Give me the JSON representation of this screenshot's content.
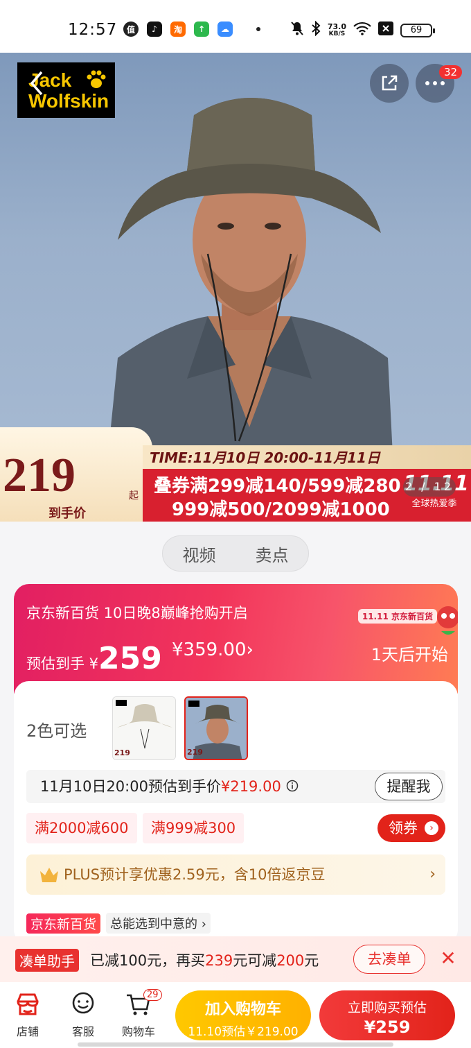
{
  "status_bar": {
    "time": "12:57",
    "net_speed_value": "73.0",
    "net_speed_unit": "KB/S",
    "battery": "69",
    "icons": [
      "value-app-icon",
      "tiktok-icon",
      "taobao-icon",
      "green-app-icon",
      "blue-app-icon",
      "dot-icon",
      "mute-icon",
      "bluetooth-icon",
      "wifi-icon",
      "x-icon",
      "battery-icon"
    ]
  },
  "hero": {
    "brand_line1": "Jack",
    "brand_line2": "Wolfskin",
    "more_badge": "32",
    "price": "219",
    "price_suffix": "起",
    "price_label": "到手价",
    "time_banner": "TIME:11月10日 20:00-11月11日",
    "promo_line1": "叠券满299减140/599减280",
    "promo_line2": "999减500/2099减1000",
    "event_logo": "11.11",
    "event_sub": "全球热爱季",
    "pager": "2 / 12",
    "colors": {
      "brand_bg": "#000000",
      "brand_fg": "#f7c600",
      "promo_red": "#d8202f"
    }
  },
  "segment": {
    "tabs": [
      "视频",
      "卖点"
    ]
  },
  "card": {
    "title": "京东新百货 10日晚8巅峰抢购开启",
    "est_label": "预估到手 ¥",
    "est_value": "259",
    "orig_price": "¥359.00",
    "orig_chevron": "›",
    "start_text": "1天后开始",
    "mini_logo": "11.11 京东新百货",
    "colors_label": "2色可选",
    "thumbs": [
      {
        "price": "219",
        "variant": "beige"
      },
      {
        "price": "219",
        "variant": "grey"
      }
    ],
    "remind_text_prefix": "11月10日20:00预估到手价",
    "remind_price": "¥219.00",
    "remind_button": "提醒我",
    "coupons": [
      "满2000减600",
      "满999减300"
    ],
    "get_coupon": "领券",
    "plus_text": "PLUS预计享优惠2.59元，含10倍返京豆",
    "store_tag": "京东新百货",
    "store_desc": "总能选到中意的 ›"
  },
  "bundle": {
    "tag": "凑单助手",
    "text_prefix": "已减100元，再买",
    "amount1": "239",
    "text_mid": "元可减",
    "amount2": "200",
    "text_suffix": "元",
    "go_button": "去凑单",
    "close": "✕"
  },
  "bottom_bar": {
    "shop": "店铺",
    "service": "客服",
    "cart": "购物车",
    "cart_badge": "29",
    "add_cart_line1": "加入购物车",
    "add_cart_line2": "11.10预估￥219.00",
    "buy_line1": "立即购买预估",
    "buy_line2": "¥259",
    "colors": {
      "add_cart": "#ffb800",
      "buy": "#e2231a"
    }
  }
}
